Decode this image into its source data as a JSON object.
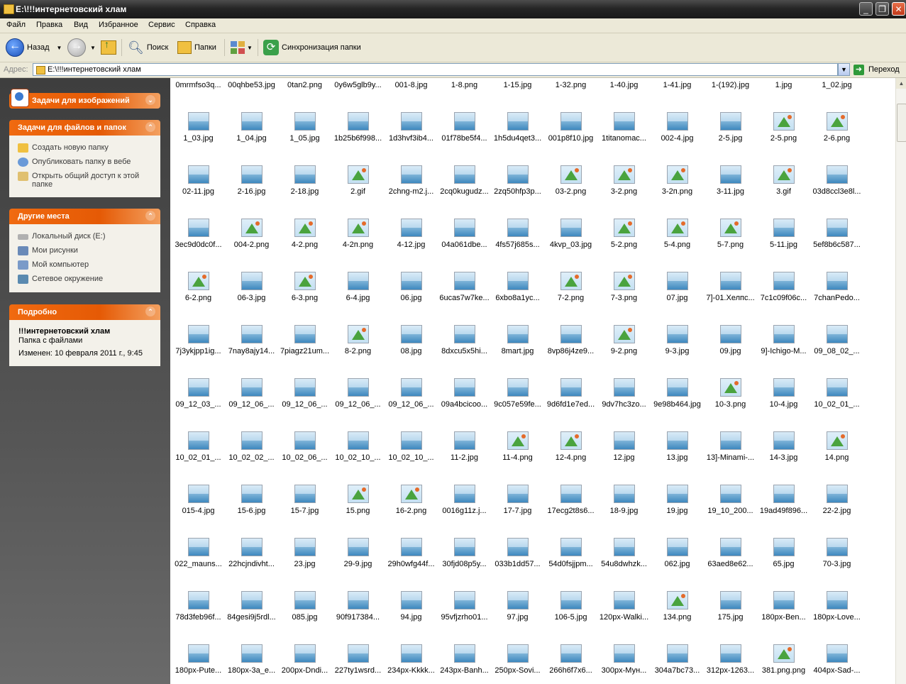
{
  "window": {
    "title": "E:\\!!!интернетовский хлам",
    "minimize": "_",
    "restore": "❐",
    "close": "✕"
  },
  "menu": [
    "Файл",
    "Правка",
    "Вид",
    "Избранное",
    "Сервис",
    "Справка"
  ],
  "toolbar": {
    "back_label": "Назад",
    "search_label": "Поиск",
    "folders_label": "Папки",
    "sync_label": "Синхронизация папки"
  },
  "address": {
    "label": "Адрес:",
    "path": "E:\\!!!интернетовский хлам",
    "go_label": "Переход"
  },
  "sidebar": {
    "image_tasks": {
      "title": "Задачи для изображений"
    },
    "file_tasks": {
      "title": "Задачи для файлов и папок",
      "items": [
        {
          "label": "Создать новую папку",
          "icon": "new-folder-icon"
        },
        {
          "label": "Опубликовать папку в вебе",
          "icon": "web-publish-icon"
        },
        {
          "label": "Открыть общий доступ к этой папке",
          "icon": "share-folder-icon"
        }
      ]
    },
    "other_places": {
      "title": "Другие места",
      "items": [
        {
          "label": "Локальный диск (E:)",
          "icon": "drive-icon"
        },
        {
          "label": "Мои рисунки",
          "icon": "my-pictures-icon"
        },
        {
          "label": "Мой компьютер",
          "icon": "my-computer-icon"
        },
        {
          "label": "Сетевое окружение",
          "icon": "network-icon"
        }
      ]
    },
    "details": {
      "title": "Подробно",
      "name": "!!!интернетовский хлам",
      "type": "Папка с файлами",
      "modified": "Изменен: 10 февраля 2011 г., 9:45"
    }
  },
  "files_top_row": [
    "0mrmfso3q...",
    "00qhbe53.jpg",
    "0tan2.png",
    "0y6w5glb9y...",
    "001-8.jpg",
    "1-8.png",
    "1-15.jpg",
    "1-32.png",
    "1-40.jpg",
    "1-41.jpg",
    "1-(192).jpg",
    "1.jpg",
    "1_02.jpg"
  ],
  "files": [
    [
      "1_03.jpg",
      "1_04.jpg",
      "1_05.jpg",
      "1b25b6f998...",
      "1d3hvf3ib4...",
      "01f78be5f4...",
      "1h5du4qet3...",
      "001p8f10.jpg",
      "1titanomac...",
      "002-4.jpg",
      "2-5.jpg",
      "2-5.png",
      "2-6.png"
    ],
    [
      "02-11.jpg",
      "2-16.jpg",
      "2-18.jpg",
      "2.gif",
      "2chng-m2.j...",
      "2cq0kugudz...",
      "2zq50hfp3p...",
      "03-2.png",
      "3-2.png",
      "3-2п.png",
      "3-11.jpg",
      "3.gif",
      "03d8ccl3e8l..."
    ],
    [
      "3ec9d0dc0f...",
      "004-2.png",
      "4-2.png",
      "4-2п.png",
      "4-12.jpg",
      "04a061dbe...",
      "4fs57j685s...",
      "4kvp_03.jpg",
      "5-2.png",
      "5-4.png",
      "5-7.png",
      "5-11.jpg",
      "5ef8b6c587..."
    ],
    [
      "6-2.png",
      "06-3.jpg",
      "6-3.png",
      "6-4.jpg",
      "06.jpg",
      "6ucas7w7ke...",
      "6xbo8a1yc...",
      "7-2.png",
      "7-3.png",
      "07.jpg",
      "7]-01.Хелпс...",
      "7c1c09f06c...",
      "7chanPedo..."
    ],
    [
      "7j3ykjpp1ig...",
      "7nay8ajy14...",
      "7piagz21um...",
      "8-2.png",
      "08.jpg",
      "8dxcu5x5hi...",
      "8mart.jpg",
      "8vp86j4ze9...",
      "9-2.png",
      "9-3.jpg",
      "09.jpg",
      "9]-Ichigo-M...",
      "09_08_02_..."
    ],
    [
      "09_12_03_...",
      "09_12_06_...",
      "09_12_06_...",
      "09_12_06_...",
      "09_12_06_...",
      "09a4bcicoo...",
      "9c057e59fe...",
      "9d6fd1e7ed...",
      "9dv7hc3zo...",
      "9e98b464.jpg",
      "10-3.png",
      "10-4.jpg",
      "10_02_01_..."
    ],
    [
      "10_02_01_...",
      "10_02_02_...",
      "10_02_06_...",
      "10_02_10_...",
      "10_02_10_...",
      "11-2.jpg",
      "11-4.png",
      "12-4.png",
      "12.jpg",
      "13.jpg",
      "13]-Minami-...",
      "14-3.jpg",
      "14.png"
    ],
    [
      "015-4.jpg",
      "15-6.jpg",
      "15-7.jpg",
      "15.png",
      "16-2.png",
      "0016g11z.j...",
      "17-7.jpg",
      "17ecg2t8s6...",
      "18-9.jpg",
      "19.jpg",
      "19_10_200...",
      "19ad49f896...",
      "22-2.jpg"
    ],
    [
      "022_mauns...",
      "22hcjndivht...",
      "23.jpg",
      "29-9.jpg",
      "29h0wfg44f...",
      "30fjd08p5y...",
      "033b1dd57...",
      "54d0fsjjpm...",
      "54u8dwhzk...",
      "062.jpg",
      "63aed8e62...",
      "65.jpg",
      "70-3.jpg"
    ],
    [
      "78d3feb96f...",
      "84gesi9j5rdl...",
      "085.jpg",
      "90f917384...",
      "94.jpg",
      "95vfjzrho01...",
      "97.jpg",
      "106-5.jpg",
      "120px-Walki...",
      "134.png",
      "175.jpg",
      "180px-Ben...",
      "180px-Love..."
    ],
    [
      "180px-Pute...",
      "180px-3a_e...",
      "200px-Dndi...",
      "227ty1wsrd...",
      "234px-Kkkk...",
      "243px-Banh...",
      "250px-Sovi...",
      "266h6f7x6...",
      "300px-Мун...",
      "304a7bc73...",
      "312px-1263...",
      "381.png.png",
      "404px-Sad-..."
    ]
  ]
}
